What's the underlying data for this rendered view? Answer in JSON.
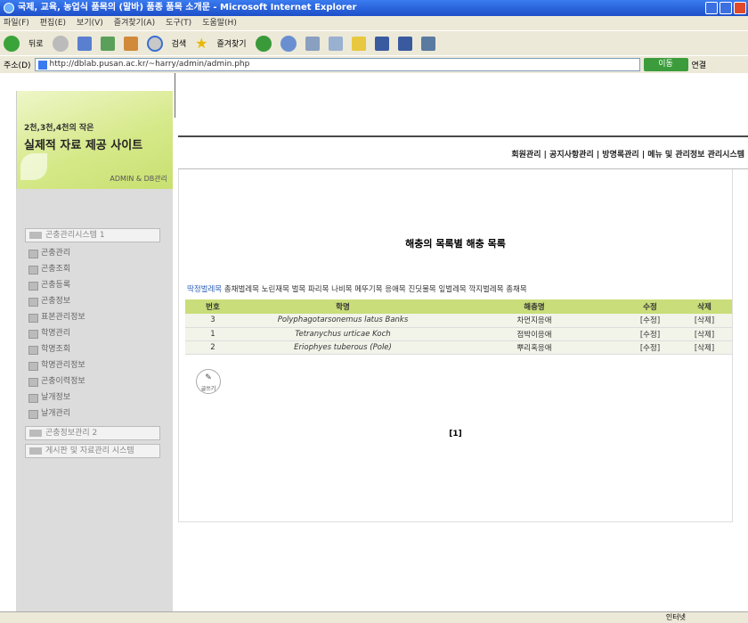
{
  "window": {
    "title": "Microsoft Internet Explorer",
    "title_prefix": "국제, 교육, 농업식 품목의 (말바) 품종 품목 소개문 -"
  },
  "menubar": [
    "파일(F)",
    "편집(E)",
    "보기(V)",
    "즐겨찾기(A)",
    "도구(T)",
    "도움말(H)"
  ],
  "toolbar": {
    "back": "뒤로",
    "search": "검색",
    "favorites": "즐겨찾기"
  },
  "address": {
    "label": "주소(D)",
    "url": "http://dblab.pusan.ac.kr/~harry/admin/admin.php",
    "go": "이동",
    "links": "연결"
  },
  "banner": {
    "line1": "2천,3천,4천의 작은",
    "line2": "실제적 자료 제공 사이트",
    "sub": "ADMIN & DB관리"
  },
  "leftnav": {
    "header1": "곤충관리시스템 1",
    "items": [
      "곤충관리",
      "곤충조회",
      "곤충등록",
      "곤충정보",
      "표본관리정보",
      "학명관리",
      "학명조회",
      "학명관리정보",
      "곤충이력정보",
      "날개정보",
      "날개관리"
    ],
    "header2": "곤충정보관리 2",
    "header3": "게시판 및 자료관리 시스템"
  },
  "topnav": "회원관리 | 공지사항관리 | 방명록관리 | 메뉴 및 관리정보 관리시스템",
  "content": {
    "page_title": "해충의 목록별 해충 목록",
    "categories": [
      "딱정벌레목",
      "총채벌레목",
      "노린재목",
      "벌목",
      "파리목",
      "나비목",
      "메뚜기목",
      "응애목",
      "진딧물목",
      "잎벌레목",
      "깍지벌레목",
      "총채목"
    ],
    "active_category": 0,
    "table": {
      "headers": [
        "번호",
        "학명",
        "해충명",
        "수정",
        "삭제"
      ],
      "rows": [
        {
          "no": "3",
          "sci": "Polyphagotarsonemus latus Banks",
          "name": "차먼지응애",
          "edit": "[수정]",
          "del": "[삭제]"
        },
        {
          "no": "1",
          "sci": "Tetranychus urticae Koch",
          "name": "점박이응애",
          "edit": "[수정]",
          "del": "[삭제]"
        },
        {
          "no": "2",
          "sci": "Eriophyes tuberous (Pole)",
          "name": "뿌리혹응애",
          "edit": "[수정]",
          "del": "[삭제]"
        }
      ]
    },
    "write_label": "글쓰기",
    "pager": "[1]"
  },
  "statusbar": {
    "zone": "인터넷"
  },
  "colors": {
    "table_header": "#c9dd7a",
    "banner": "#d6e98a",
    "nav_bg": "#dcdcdc"
  }
}
